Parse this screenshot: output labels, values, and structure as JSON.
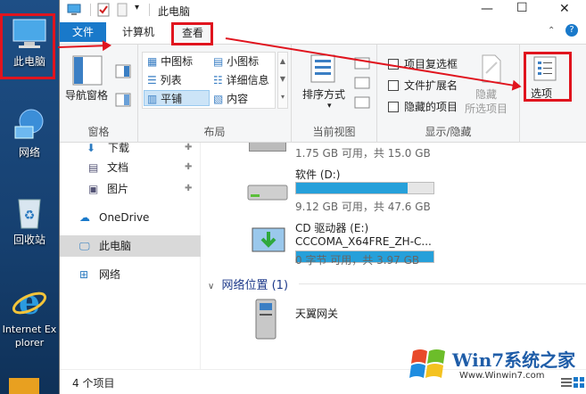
{
  "desktop": {
    "icons": [
      {
        "label": "此电脑"
      },
      {
        "label": "网络"
      },
      {
        "label": "回收站"
      },
      {
        "label": "Internet Explorer"
      }
    ]
  },
  "window": {
    "title": "此电脑",
    "controls": {
      "minimize": "—",
      "maximize": "☐",
      "close": "✕"
    }
  },
  "tabs": {
    "file": "文件",
    "computer": "计算机",
    "view": "查看"
  },
  "ribbon": {
    "panes": {
      "nav_pane": "导航窗格",
      "group": "窗格"
    },
    "layout": {
      "items": [
        "中图标",
        "小图标",
        "列表",
        "详细信息",
        "平铺",
        "内容"
      ],
      "group": "布局"
    },
    "current_view": {
      "sort": "排序方式",
      "group": "当前视图"
    },
    "show_hide": {
      "item_checkbox": "项目复选框",
      "file_ext": "文件扩展名",
      "hidden_items": "隐藏的项目",
      "hide": "隐藏",
      "hide_sub": "所选项目",
      "group": "显示/隐藏"
    },
    "options": "选项"
  },
  "nav": {
    "items": [
      "下载",
      "文档",
      "图片",
      "OneDrive",
      "此电脑",
      "网络"
    ]
  },
  "content": {
    "drive_c": {
      "info": "1.75 GB 可用，共 15.0 GB"
    },
    "drive_d": {
      "name": "软件 (D:)",
      "info": "9.12 GB 可用，共 47.6 GB",
      "used_fraction": 0.81
    },
    "drive_e": {
      "name": "CD 驱动器 (E:)",
      "label": "CCCOMA_X64FRE_ZH-C...",
      "info": "0 字节 可用，共 3.97 GB",
      "used_fraction": 1.0
    },
    "network_header": "网络位置 (1)",
    "network_item": "天翼网关"
  },
  "status": {
    "count": "4 个项目"
  },
  "watermark": {
    "brand": "Win7系统之家",
    "url": "Www.Winwin7.com"
  },
  "colors": {
    "accent": "#1979ca",
    "red": "#e0141e",
    "bar": "#26a0da"
  }
}
